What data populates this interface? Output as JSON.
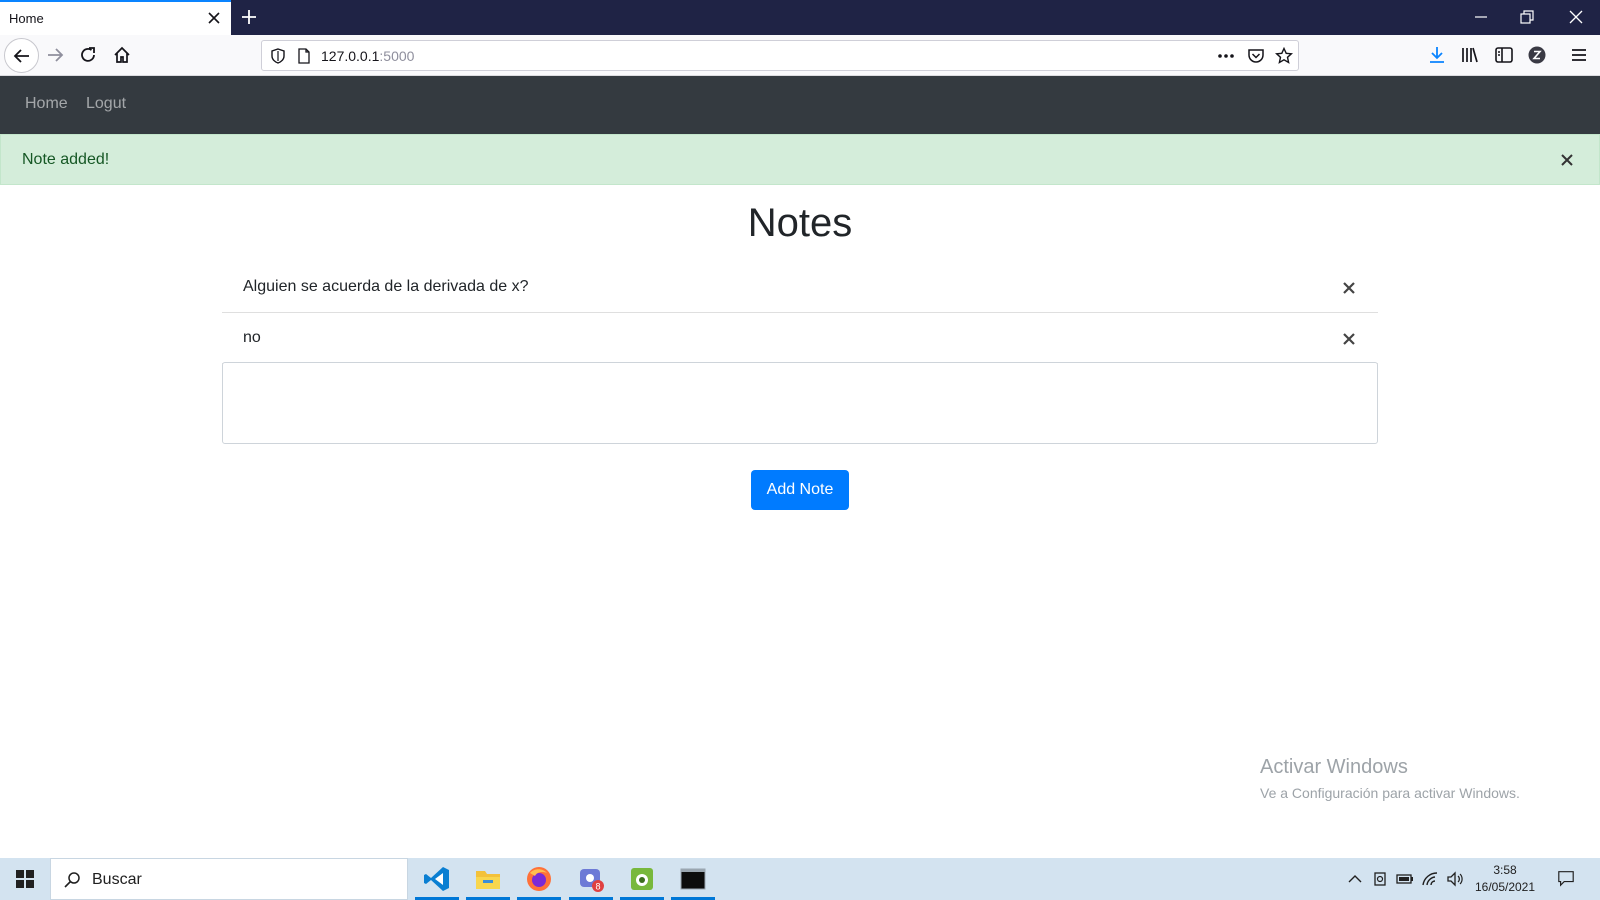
{
  "browser": {
    "tab": {
      "title": "Home"
    },
    "url": {
      "host": "127.0.0.1",
      "port": ":5000"
    }
  },
  "navbar": {
    "links": [
      "Home",
      "Logut"
    ]
  },
  "alert": {
    "message": "Note added!"
  },
  "page": {
    "title": "Notes"
  },
  "notes": [
    "Alguien se acuerda de la derivada de x?",
    "no"
  ],
  "form": {
    "note_value": "",
    "submit_label": "Add Note"
  },
  "watermark": {
    "title": "Activar Windows",
    "subtitle": "Ve a Configuración para activar Windows."
  },
  "taskbar": {
    "search_placeholder": "Buscar",
    "apps": [
      "vscode-icon",
      "file-explorer-icon",
      "firefox-icon",
      "chat-app-icon",
      "android-studio-icon",
      "terminal-icon"
    ],
    "chat_badge": "8",
    "clock": {
      "time": "3:58",
      "date": "16/05/2021"
    }
  },
  "colors": {
    "navbar_bg": "#343a40",
    "alert_bg": "#d4edda",
    "primary": "#007bff",
    "tabstrip_bg": "#1f2345"
  }
}
